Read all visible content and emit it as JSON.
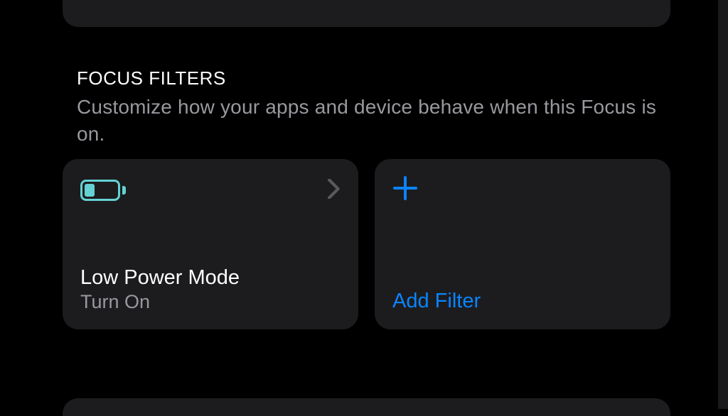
{
  "section": {
    "title": "FOCUS FILTERS",
    "description": "Customize how your apps and device behave when this Focus is on."
  },
  "filters": {
    "lowPower": {
      "title": "Low Power Mode",
      "subtitle": "Turn On"
    },
    "add": {
      "label": "Add Filter"
    }
  }
}
